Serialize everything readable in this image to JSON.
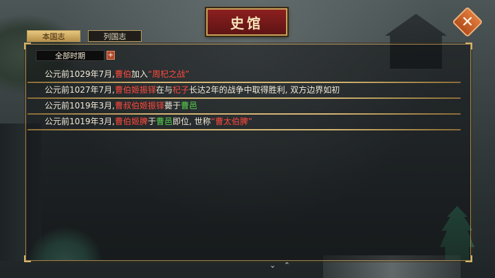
{
  "window": {
    "title": "史馆"
  },
  "close_icon": {
    "glyph": "✕"
  },
  "tabs": [
    {
      "label": "本国志",
      "active": true
    },
    {
      "label": "列国志",
      "active": false
    }
  ],
  "filter": {
    "value": "全部时期",
    "button": "+"
  },
  "records": [
    {
      "segments": [
        {
          "text": "公元前1029年7月,",
          "color": "white"
        },
        {
          "text": "曹伯",
          "color": "red"
        },
        {
          "text": "加入",
          "color": "white"
        },
        {
          "text": "“周杞之战”",
          "color": "red"
        }
      ]
    },
    {
      "segments": [
        {
          "text": "公元前1027年7月,",
          "color": "white"
        },
        {
          "text": "曹伯姬振铎",
          "color": "red"
        },
        {
          "text": "在与",
          "color": "white"
        },
        {
          "text": "杞子",
          "color": "red"
        },
        {
          "text": "长达2年的战争中取得胜利, 双方边界如初",
          "color": "white"
        }
      ]
    },
    {
      "segments": [
        {
          "text": "公元前1019年3月,",
          "color": "white"
        },
        {
          "text": "曹叔伯姬振铎",
          "color": "red"
        },
        {
          "text": "薨于",
          "color": "white"
        },
        {
          "text": "曹邑",
          "color": "green"
        }
      ]
    },
    {
      "segments": [
        {
          "text": "公元前1019年3月,",
          "color": "white"
        },
        {
          "text": "曹伯姬脾",
          "color": "red"
        },
        {
          "text": "于",
          "color": "white"
        },
        {
          "text": "曹邑",
          "color": "green"
        },
        {
          "text": "即位, 世称",
          "color": "white"
        },
        {
          "text": "“曹太伯脾”",
          "color": "red"
        }
      ]
    }
  ],
  "bottom_hint": "⌄ ⌃",
  "colors": {
    "red": "#ff4a3d",
    "green": "#58d64e",
    "white": "#f2ead8",
    "gold": "#d7b874"
  }
}
